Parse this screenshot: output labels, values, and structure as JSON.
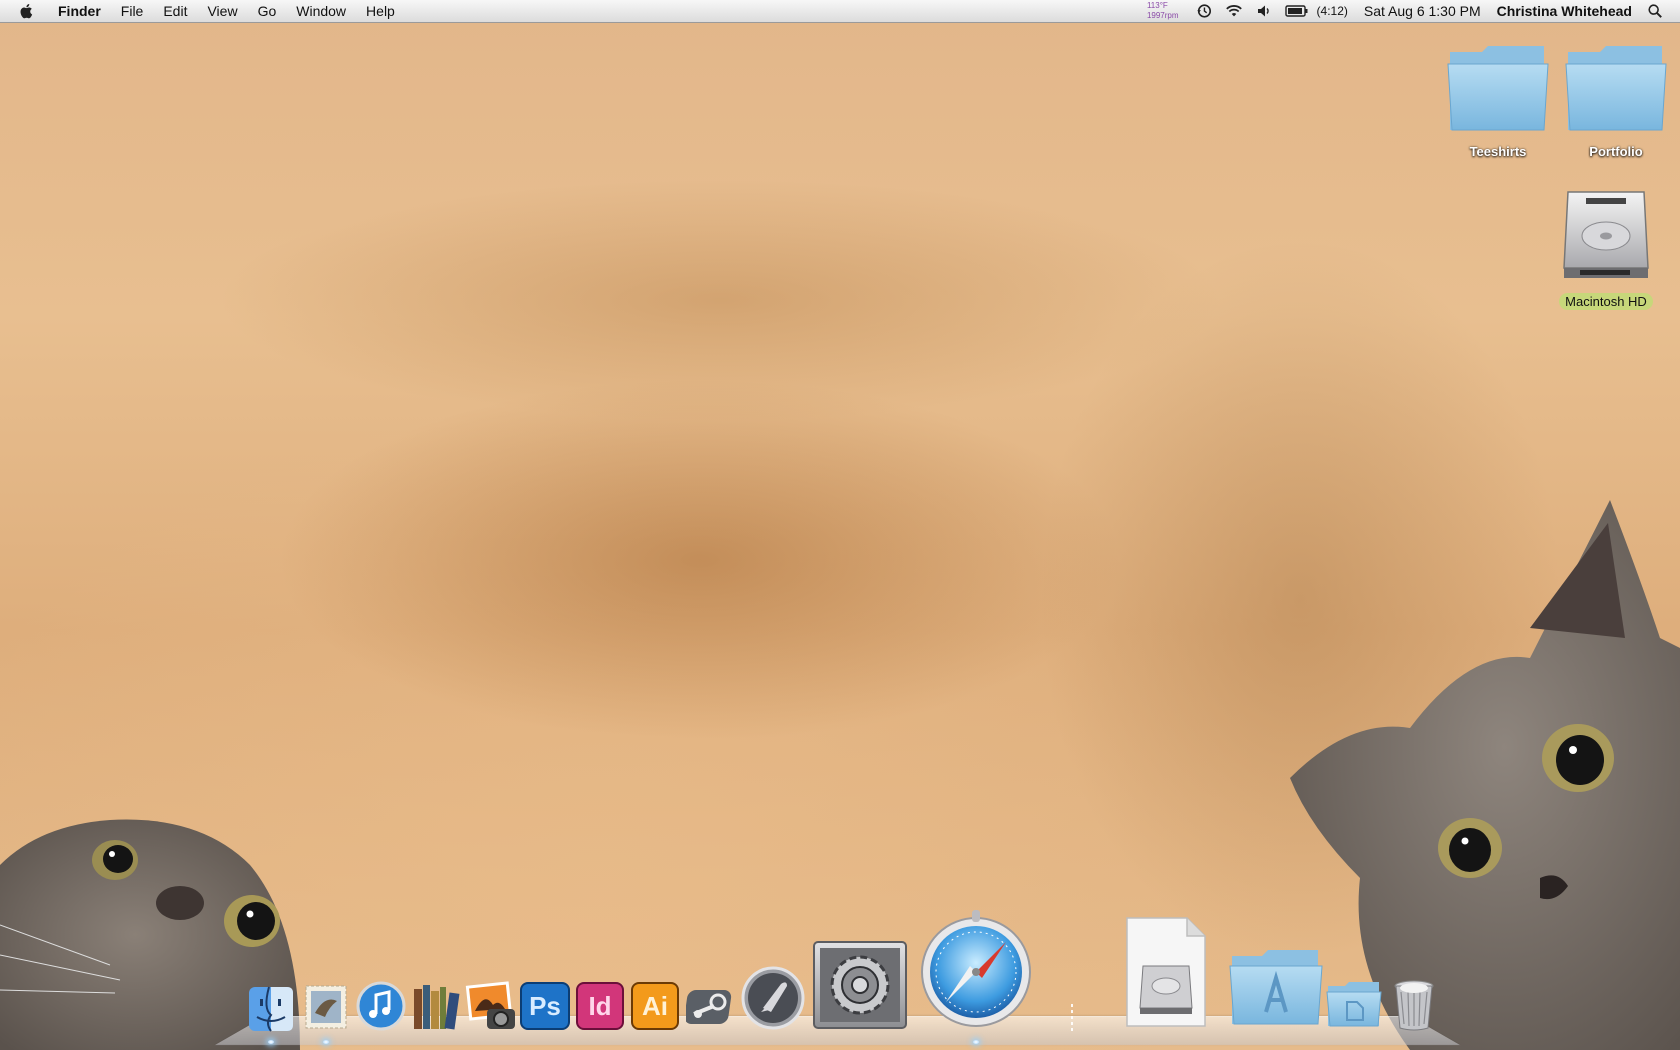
{
  "menubar": {
    "app_name": "Finder",
    "menus": [
      "File",
      "Edit",
      "View",
      "Go",
      "Window",
      "Help"
    ],
    "temp_widget": {
      "temperature": "113°F",
      "fan_speed": "1997rpm"
    },
    "battery_time": "(4:12)",
    "datetime": "Sat Aug 6  1:30 PM",
    "user_name": "Christina Whitehead",
    "icons": [
      "apple-icon",
      "time-machine-icon",
      "wifi-icon",
      "volume-icon",
      "battery-icon",
      "spotlight-icon"
    ]
  },
  "desktop": {
    "items": [
      {
        "label": "Teeshirts",
        "kind": "folder"
      },
      {
        "label": "Portfolio",
        "kind": "folder"
      },
      {
        "label": "Macintosh HD",
        "kind": "hard-drive",
        "selected": true
      }
    ],
    "label_selected_color": "#c7d77a"
  },
  "dock": {
    "apps": [
      {
        "name": "Finder",
        "icon": "finder-icon",
        "running": true
      },
      {
        "name": "Mail",
        "icon": "mail-icon",
        "running": true
      },
      {
        "name": "iTunes",
        "icon": "itunes-icon",
        "running": false
      },
      {
        "name": "iBooks Library",
        "icon": "books-icon",
        "running": false
      },
      {
        "name": "iPhoto",
        "icon": "iphoto-icon",
        "running": false
      },
      {
        "name": "Photoshop",
        "icon": "photoshop-icon",
        "glyph": "Ps",
        "running": false
      },
      {
        "name": "InDesign",
        "icon": "indesign-icon",
        "glyph": "Id",
        "running": false
      },
      {
        "name": "Illustrator",
        "icon": "illustrator-icon",
        "glyph": "Ai",
        "running": false
      },
      {
        "name": "Steam",
        "icon": "steam-icon",
        "running": false
      },
      {
        "name": "Launchpad",
        "icon": "launchpad-icon",
        "running": false
      },
      {
        "name": "System Preferences",
        "icon": "system-preferences-icon",
        "running": false
      },
      {
        "name": "Safari",
        "icon": "safari-icon",
        "running": true
      }
    ],
    "stacks": [
      {
        "name": "Disk Image",
        "icon": "disk-image-document-icon"
      },
      {
        "name": "Applications",
        "icon": "applications-folder-icon"
      },
      {
        "name": "Documents",
        "icon": "documents-folder-icon"
      },
      {
        "name": "Trash",
        "icon": "trash-icon"
      }
    ],
    "brand_colors": {
      "photoshop": "#1e73c8",
      "indesign": "#d2367a",
      "illustrator": "#f39a1b"
    }
  }
}
